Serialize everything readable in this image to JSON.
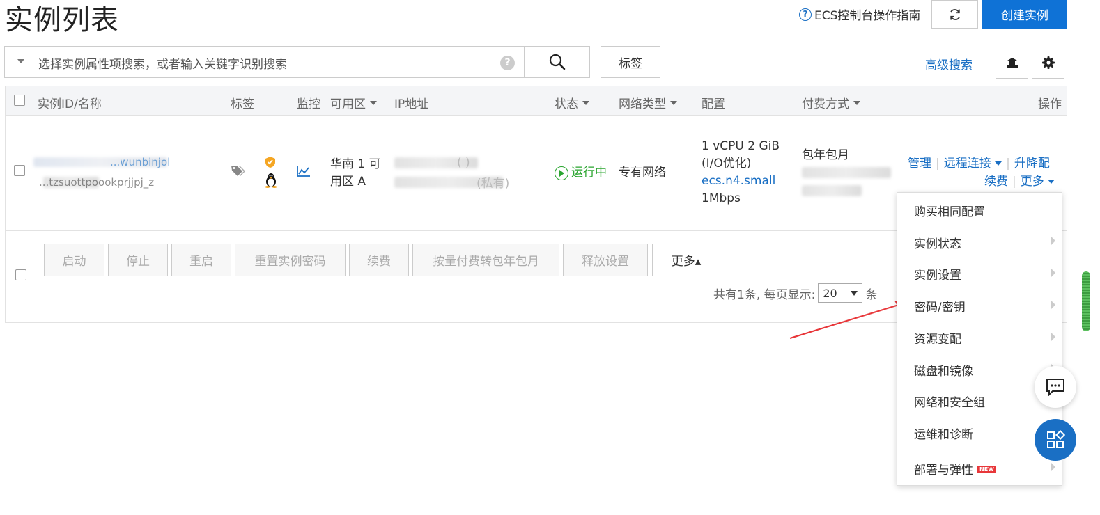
{
  "page": {
    "title": "实例列表",
    "guide_link": "ECS控制台操作指南",
    "create_button": "创建实例"
  },
  "search": {
    "placeholder": "选择实例属性项搜索，或者输入关键字识别搜索",
    "help": "?",
    "tags_button": "标签",
    "advanced_search": "高级搜索"
  },
  "table": {
    "columns": [
      "实例ID/名称",
      "标签",
      "监控",
      "可用区",
      "IP地址",
      "状态",
      "网络类型",
      "配置",
      "付费方式",
      "操作"
    ],
    "rows": [
      {
        "id_line1": "...wunbinjol",
        "id_line2": "...tzsuottpoookprjjpj_z",
        "zone_line1": "华南 1 可",
        "zone_line2": "用区 A",
        "ip_suffix1": "( )",
        "ip_suffix2": "(私有)",
        "status": "运行中",
        "network": "专有网络",
        "config_line1": "1 vCPU 2 GiB",
        "config_line2": "(I/O优化)",
        "config_type": "ecs.n4.small",
        "config_bandwidth": "1Mbps",
        "billing": "包年包月",
        "actions": {
          "manage": "管理",
          "remote": "远程连接",
          "upgrade": "升降配",
          "renew": "续费",
          "more": "更多"
        }
      }
    ]
  },
  "batch": {
    "buttons": [
      "启动",
      "停止",
      "重启",
      "重置实例密码",
      "续费",
      "按量付费转包年包月",
      "释放设置"
    ],
    "more": "更多▴"
  },
  "pager": {
    "total_text": "共有1条, 每页显示:",
    "page_size": "20",
    "unit": "条"
  },
  "dropdown_menu": {
    "items": [
      {
        "label": "购买相同配置",
        "submenu": false
      },
      {
        "label": "实例状态",
        "submenu": true
      },
      {
        "label": "实例设置",
        "submenu": true
      },
      {
        "label": "密码/密钥",
        "submenu": true
      },
      {
        "label": "资源变配",
        "submenu": true
      },
      {
        "label": "磁盘和镜像",
        "submenu": true
      },
      {
        "label": "网络和安全组",
        "submenu": true
      },
      {
        "label": "运维和诊断",
        "submenu": true
      },
      {
        "label": "部署与弹性",
        "submenu": true,
        "badge": "NEW"
      }
    ]
  },
  "colors": {
    "brand": "#0f72d6",
    "link": "#1a6fc4",
    "status_running": "#2aa52f",
    "annotation_arrow": "#e8373a"
  }
}
